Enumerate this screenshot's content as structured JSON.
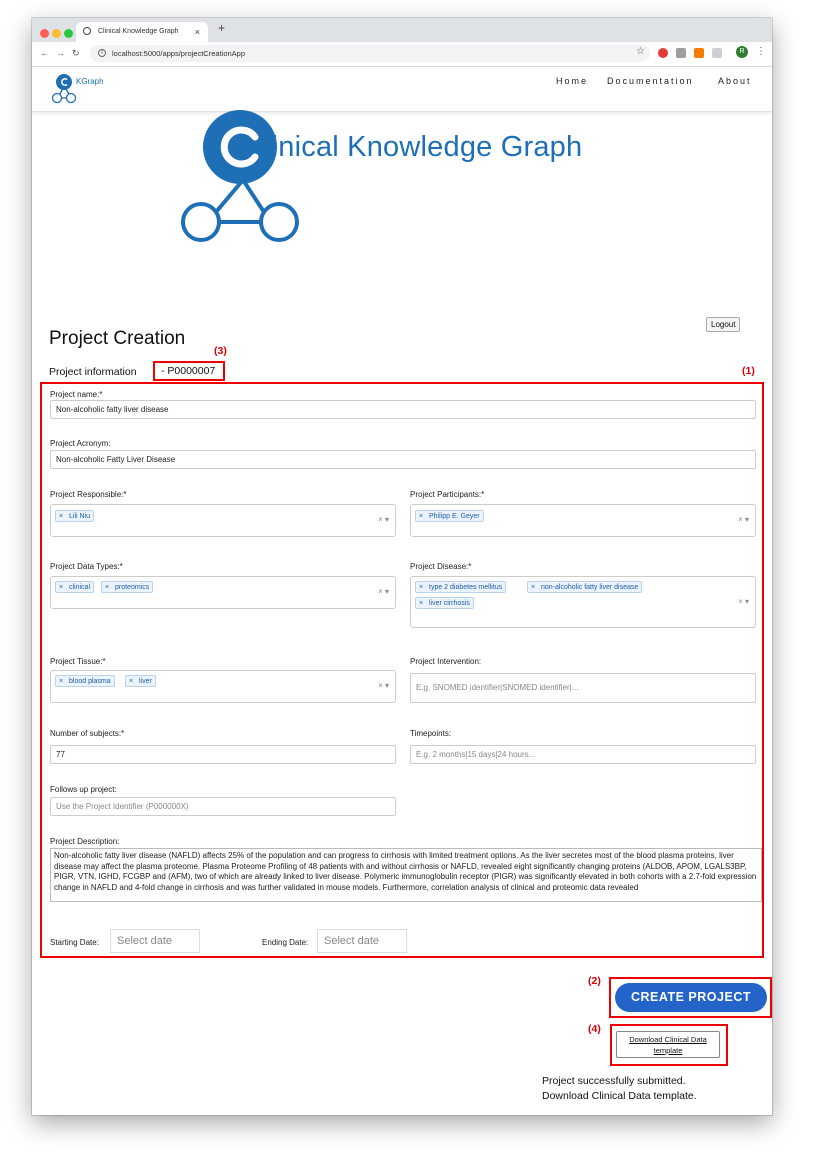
{
  "browser": {
    "tab_title": "Clinical Knowledge Graph",
    "tab_close": "×",
    "new_tab": "+",
    "url": "localhost:5000/apps/projectCreationApp",
    "profile_initial": "R"
  },
  "navbar": {
    "brand_small": "KGraph",
    "links": [
      "Home",
      "Documentation",
      "About"
    ]
  },
  "logo": {
    "title": "linical Knowledge Graph"
  },
  "page": {
    "title": "Project Creation",
    "logout": "Logout",
    "info_label": "Project information",
    "project_id": "- P0000007"
  },
  "annotations": {
    "a1": "(1)",
    "a2": "(2)",
    "a3": "(3)",
    "a4": "(4)"
  },
  "form": {
    "name_label": "Project name:*",
    "name_value": "Non-alcoholic fatty liver disease",
    "acronym_label": "Project Acronym:",
    "acronym_value": "Non-alcoholic Fatty Liver Disease",
    "responsible_label": "Project Responsible:*",
    "responsible_chips": [
      "Lili Niu"
    ],
    "participants_label": "Project Participants:*",
    "participants_chips": [
      "Philipp E. Geyer"
    ],
    "datatypes_label": "Project Data Types:*",
    "datatypes_chips": [
      "clinical",
      "proteomics"
    ],
    "disease_label": "Project Disease:*",
    "disease_chips": [
      "type 2 diabetes mellitus",
      "non-alcoholic fatty liver disease",
      "liver cirrhosis"
    ],
    "tissue_label": "Project Tissue:*",
    "tissue_chips": [
      "blood plasma",
      "liver"
    ],
    "intervention_label": "Project Intervention:",
    "intervention_placeholder": "E.g. SNOMED identifier|SNOMED identifier|...",
    "subjects_label": "Number of subjects:*",
    "subjects_value": "77",
    "timepoints_label": "Timepoints:",
    "timepoints_placeholder": "E.g. 2 months|15 days|24 hours...",
    "followup_label": "Follows up project:",
    "followup_placeholder": "Use the Project Identifier (P000000X)",
    "description_label": "Project Description:",
    "description_value": "Non-alcoholic fatty liver disease (NAFLD) affects 25% of the population and can progress to cirrhosis with limited treatment options. As the liver secretes most of the blood plasma proteins, liver disease may affect the plasma proteome. Plasma Proteome Profiling of 48 patients with and without cirrhosis or NAFLD, revealed eight significantly changing proteins (ALDOB, APOM, LGALS3BP, PIGR, VTN, IGHD, FCGBP and (AFM), two of which are already linked to liver disease. Polymeric immunoglobulin receptor (PIGR) was significantly elevated in both cohorts with a 2.7-fold expression change in NAFLD and 4-fold change in cirrhosis and was further validated in mouse models. Furthermore, correlation analysis of clinical and proteomic data revealed",
    "start_label": "Starting Date:",
    "start_placeholder": "Select date",
    "end_label": "Ending Date:",
    "end_placeholder": "Select date",
    "chip_x": "×",
    "clear_x": "×",
    "caret": "▾"
  },
  "actions": {
    "create": "CREATE PROJECT",
    "download": "Download Clinical Data template"
  },
  "status": {
    "line1": "Project successfully submitted.",
    "line2": "Download Clinical Data template."
  },
  "colors": {
    "accent": "#1e6fb5",
    "button": "#2464c9",
    "annotation": "#e00000"
  }
}
